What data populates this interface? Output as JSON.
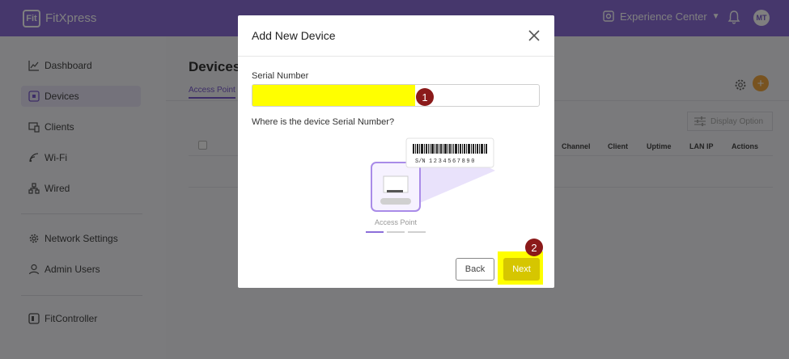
{
  "app": {
    "brand": "FitXpress",
    "logo_text": "Fit",
    "site": "Experience Center",
    "user_initials": "MT"
  },
  "sidebar": {
    "items": [
      {
        "label": "Dashboard",
        "icon": "chart-line-icon"
      },
      {
        "label": "Devices",
        "icon": "device-icon"
      },
      {
        "label": "Clients",
        "icon": "clients-icon"
      },
      {
        "label": "Wi-Fi",
        "icon": "wifi-icon"
      },
      {
        "label": "Wired",
        "icon": "wired-icon"
      },
      {
        "label": "Network Settings",
        "icon": "gear-icon"
      },
      {
        "label": "Admin Users",
        "icon": "user-icon"
      },
      {
        "label": "FitController",
        "icon": "fitcontroller-icon"
      }
    ]
  },
  "main": {
    "title": "Devices",
    "tab": "Access Point",
    "display_option": "Display Option",
    "columns": [
      "Channel",
      "Client",
      "Uptime",
      "LAN IP",
      "Actions"
    ]
  },
  "modal": {
    "title": "Add New Device",
    "serial_label": "Serial Number",
    "serial_value": "",
    "question": "Where is the device Serial Number?",
    "sn_prefix": "S/N",
    "sn_number": "1234567890",
    "device_label": "Access Point",
    "back_label": "Back",
    "next_label": "Next",
    "step_badges": [
      "1",
      "2"
    ]
  },
  "colors": {
    "brand": "#8c6fd9",
    "highlight": "#ffff00",
    "badge": "#8b1a1a",
    "add_button": "#f0a640"
  }
}
